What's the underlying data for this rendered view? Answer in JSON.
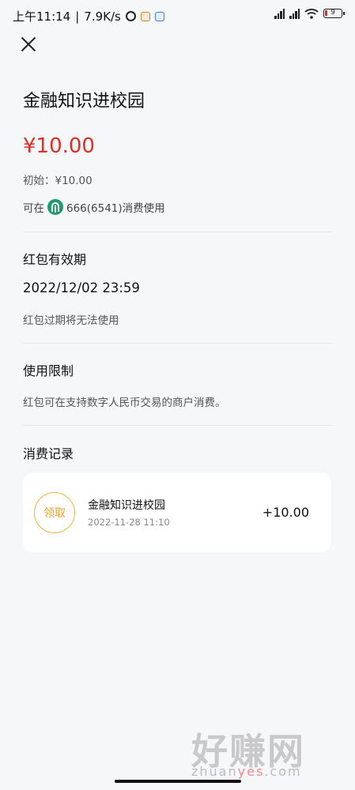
{
  "status_bar": {
    "time": "上午11:14",
    "separator": "|",
    "net_speed": "7.9K/s",
    "battery": "9"
  },
  "header": {
    "title": "金融知识进校园"
  },
  "amount": {
    "current": "¥10.00",
    "initial": "初始：¥10.00",
    "usable_prefix": "可在",
    "usable_suffix": "666(6541)消费使用"
  },
  "validity": {
    "title": "红包有效期",
    "date": "2022/12/02 23:59",
    "note": "红包过期将无法使用"
  },
  "restriction": {
    "title": "使用限制",
    "text": "红包可在支持数字人民币交易的商户消费。"
  },
  "records": {
    "title": "消费记录",
    "items": [
      {
        "badge": "领取",
        "name": "金融知识进校园",
        "time": "2022-11-28 11:10",
        "amount": "+10.00"
      }
    ]
  },
  "watermark": {
    "big": "好赚网",
    "small_pre": "zhuan",
    "small_accent": "yes",
    "small_post": ".com"
  }
}
